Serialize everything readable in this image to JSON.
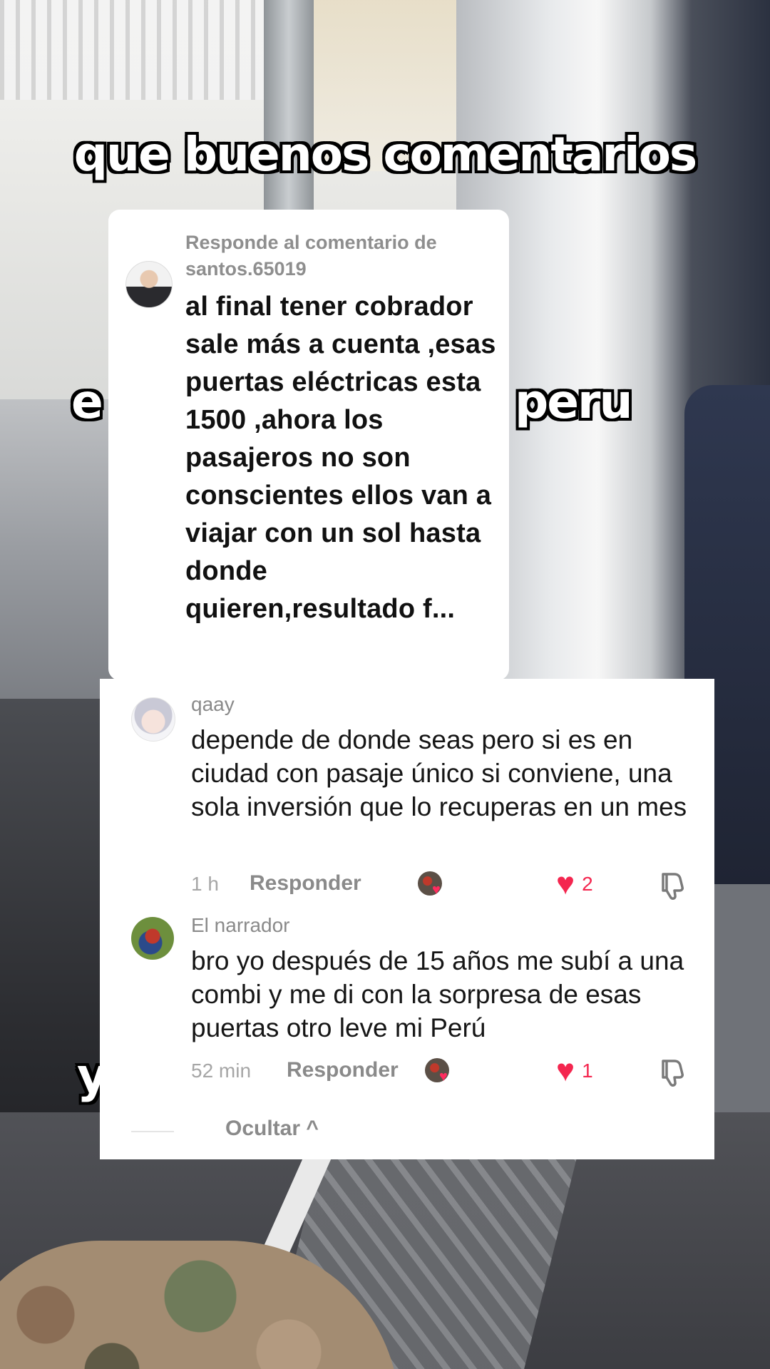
{
  "overlay": {
    "caption_top": "que buenos comentarios",
    "caption_left": "e",
    "caption_right": "peru",
    "caption_bottom": "y"
  },
  "reply_card": {
    "header": "Responde al comentario de santos.65019",
    "text": "al final tener cobrador sale más a cuenta ,esas puertas eléctricas esta 1500 ,ahora los pasajeros no son conscientes ellos van a viajar con un sol hasta donde quieren,resultado f..."
  },
  "comments": [
    {
      "username": "qaay",
      "text": "depende de donde seas pero si es en ciudad con pasaje único si conviene, una sola inversión que lo recuperas en un mes",
      "time": "1 h",
      "reply_label": "Responder",
      "likes": "2"
    },
    {
      "username": "El narrador",
      "text": "bro yo después de 15 años me subí a una combi y me di con la sorpresa de esas puertas otro leve mi Perú",
      "time": "52 min",
      "reply_label": "Responder",
      "likes": "1"
    }
  ],
  "hide_label": "Ocultar ^",
  "colors": {
    "like_red": "#f4264f",
    "muted_text": "#8a8a8a",
    "card_bg": "#ffffff"
  },
  "icons": [
    "heart-icon",
    "dislike-icon",
    "chevron-up-icon",
    "creator-liked-avatar-icon"
  ]
}
